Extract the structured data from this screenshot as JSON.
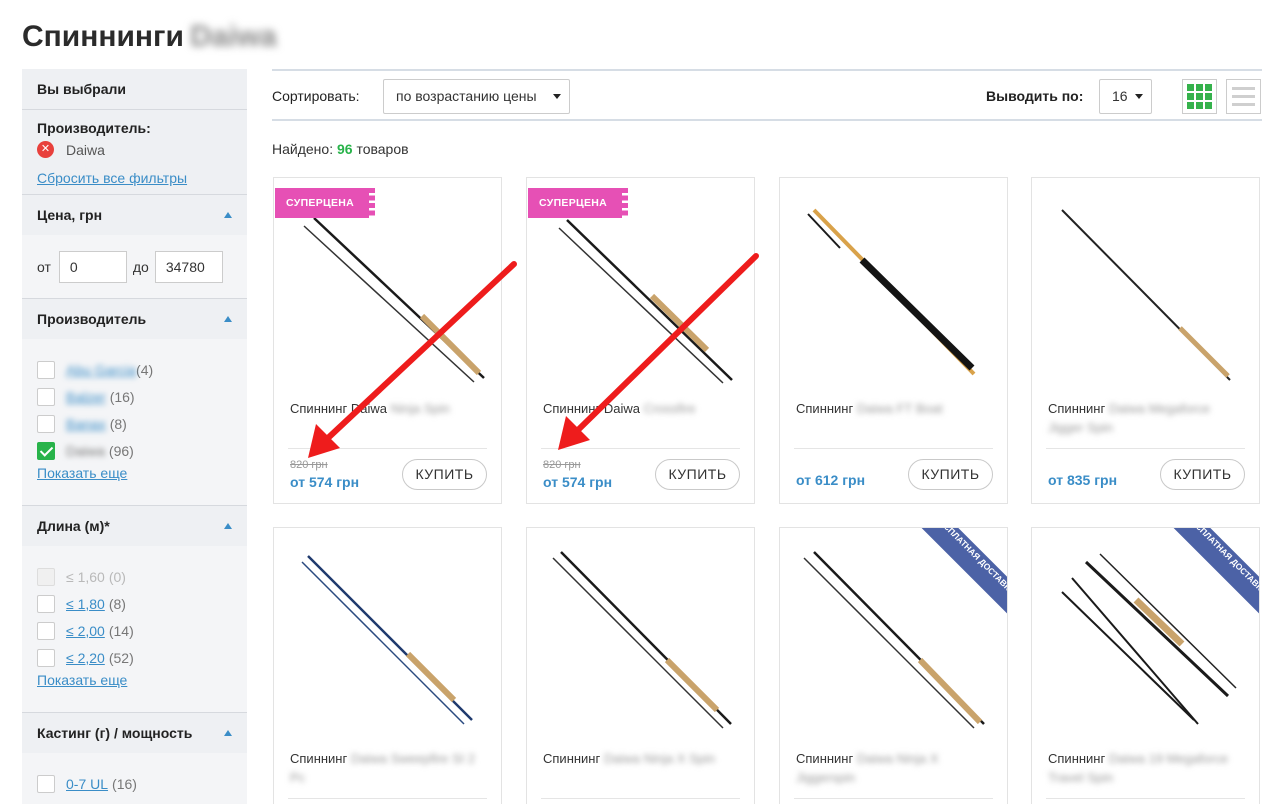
{
  "page": {
    "title": "Спиннинги",
    "title_brand": "Daiwa"
  },
  "sidebar": {
    "selected_header": "Вы выбрали",
    "manufacturer_label": "Производитель:",
    "selected_value": "Daiwa",
    "reset_link": "Сбросить все фильтры",
    "price": {
      "header": "Цена, грн",
      "from_label": "от",
      "from_value": "0",
      "to_label": "до",
      "to_value": "34780"
    },
    "brands": {
      "header": "Производитель",
      "items": [
        {
          "label": "Abu Garcia",
          "count": "(4)",
          "checked": false
        },
        {
          "label": "Balzer",
          "count": "(16)",
          "checked": false
        },
        {
          "label": "Banax",
          "count": "(8)",
          "checked": false
        },
        {
          "label": "Daiwa",
          "count": "(96)",
          "checked": true
        }
      ],
      "more": "Показать еще"
    },
    "length": {
      "header": "Длина (м)*",
      "items": [
        {
          "label": "≤ 1,60",
          "count": "(0)",
          "disabled": true
        },
        {
          "label": "≤ 1,80",
          "count": "(8)"
        },
        {
          "label": "≤ 2,00",
          "count": "(14)"
        },
        {
          "label": "≤ 2,20",
          "count": "(52)"
        }
      ],
      "more": "Показать еще"
    },
    "casting": {
      "header": "Кастинг (г) / мощность",
      "items": [
        {
          "label": "0-7 UL",
          "count": "(16)"
        }
      ]
    }
  },
  "toolbar": {
    "sort_label": "Сортировать:",
    "sort_value": "по возрастанию цены",
    "perpage_label": "Выводить по:",
    "perpage_value": "16"
  },
  "found": {
    "prefix": "Найдено:",
    "count": "96",
    "suffix": "товаров"
  },
  "products": [
    {
      "name": "Спиннинг Daiwa",
      "name_blur": "Ninja Spin",
      "old_price": "820 грн",
      "price": "от 574 грн",
      "buy": "КУПИТЬ",
      "badge": "СУПЕРЦЕНА"
    },
    {
      "name": "Спиннинг Daiwa",
      "name_blur": "Crossfire",
      "old_price": "820 грн",
      "price": "от 574 грн",
      "buy": "КУПИТЬ",
      "badge": "СУПЕРЦЕНА"
    },
    {
      "name": "Спиннинг",
      "name_blur": "Daiwa FT Boat",
      "price": "от 612 грн",
      "buy": "КУПИТЬ"
    },
    {
      "name": "Спиннинг",
      "name_blur": "Daiwa Megaforce Jigger Spin",
      "price": "от 835 грн",
      "buy": "КУПИТЬ"
    },
    {
      "name": "Спиннинг",
      "name_blur": "Daiwa Sweepfire SI 2 Pc",
      "price": "",
      "buy": ""
    },
    {
      "name": "Спиннинг",
      "name_blur": "Daiwa Ninja X Spin",
      "price": "",
      "buy": ""
    },
    {
      "name": "Спиннинг",
      "name_blur": "Daiwa Ninja X Jiggerspin",
      "price": "",
      "buy": "",
      "ribbon": "БЕСПЛАТНАЯ ДОСТАВКА"
    },
    {
      "name": "Спиннинг",
      "name_blur": "Daiwa 19 Megaforce Travel Spin",
      "price": "",
      "buy": "",
      "ribbon": "БЕСПЛАТНАЯ ДОСТАВКА"
    }
  ],
  "colors": {
    "accent": "#3a8dc7",
    "green": "#28b34a",
    "sale": "#e650b5",
    "ribbon": "#4c62a6",
    "arrow": "#ee1c1c"
  }
}
